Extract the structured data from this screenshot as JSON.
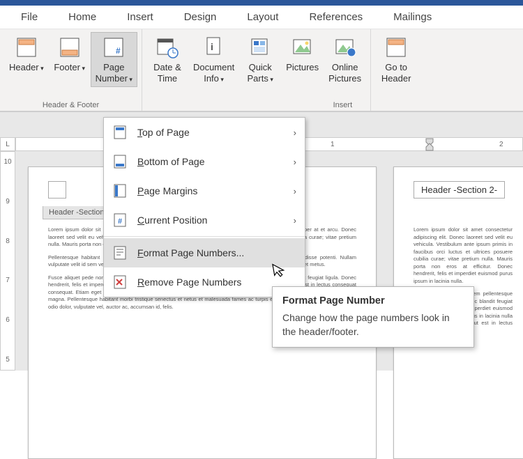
{
  "menubar": {
    "tabs": [
      "File",
      "Home",
      "Insert",
      "Design",
      "Layout",
      "References",
      "Mailings"
    ]
  },
  "ribbon": {
    "group1_label": "Header & Footer",
    "group2_label": "Insert",
    "header": "Header",
    "footer": "Footer",
    "page_number": "Page\nNumber",
    "date_time": "Date &\nTime",
    "doc_info": "Document\nInfo",
    "quick_parts": "Quick\nParts",
    "pictures": "Pictures",
    "online_pics": "Online\nPictures",
    "goto_header": "Go to\nHeader"
  },
  "menu": {
    "items": [
      {
        "label": "Top of Page",
        "has_sub": true
      },
      {
        "label": "Bottom of Page",
        "has_sub": true
      },
      {
        "label": "Page Margins",
        "has_sub": true
      },
      {
        "label": "Current Position",
        "has_sub": true
      }
    ],
    "format": "Format Page Numbers...",
    "remove": "Remove Page Numbers"
  },
  "tooltip": {
    "title": "Format Page Number",
    "body": "Change how the page numbers look in the header/footer."
  },
  "page": {
    "header_tab_left": "Header -Section 2-",
    "header_tab_right": "Header -Section 2-"
  },
  "ruler": {
    "corner": "L",
    "h_marks": [
      "",
      "",
      "",
      "",
      "",
      "",
      "",
      "1",
      "",
      "",
      "",
      "2"
    ],
    "v_marks": [
      "10",
      "",
      "9",
      "",
      "8",
      "",
      "7",
      "",
      "6",
      "",
      "5"
    ]
  }
}
